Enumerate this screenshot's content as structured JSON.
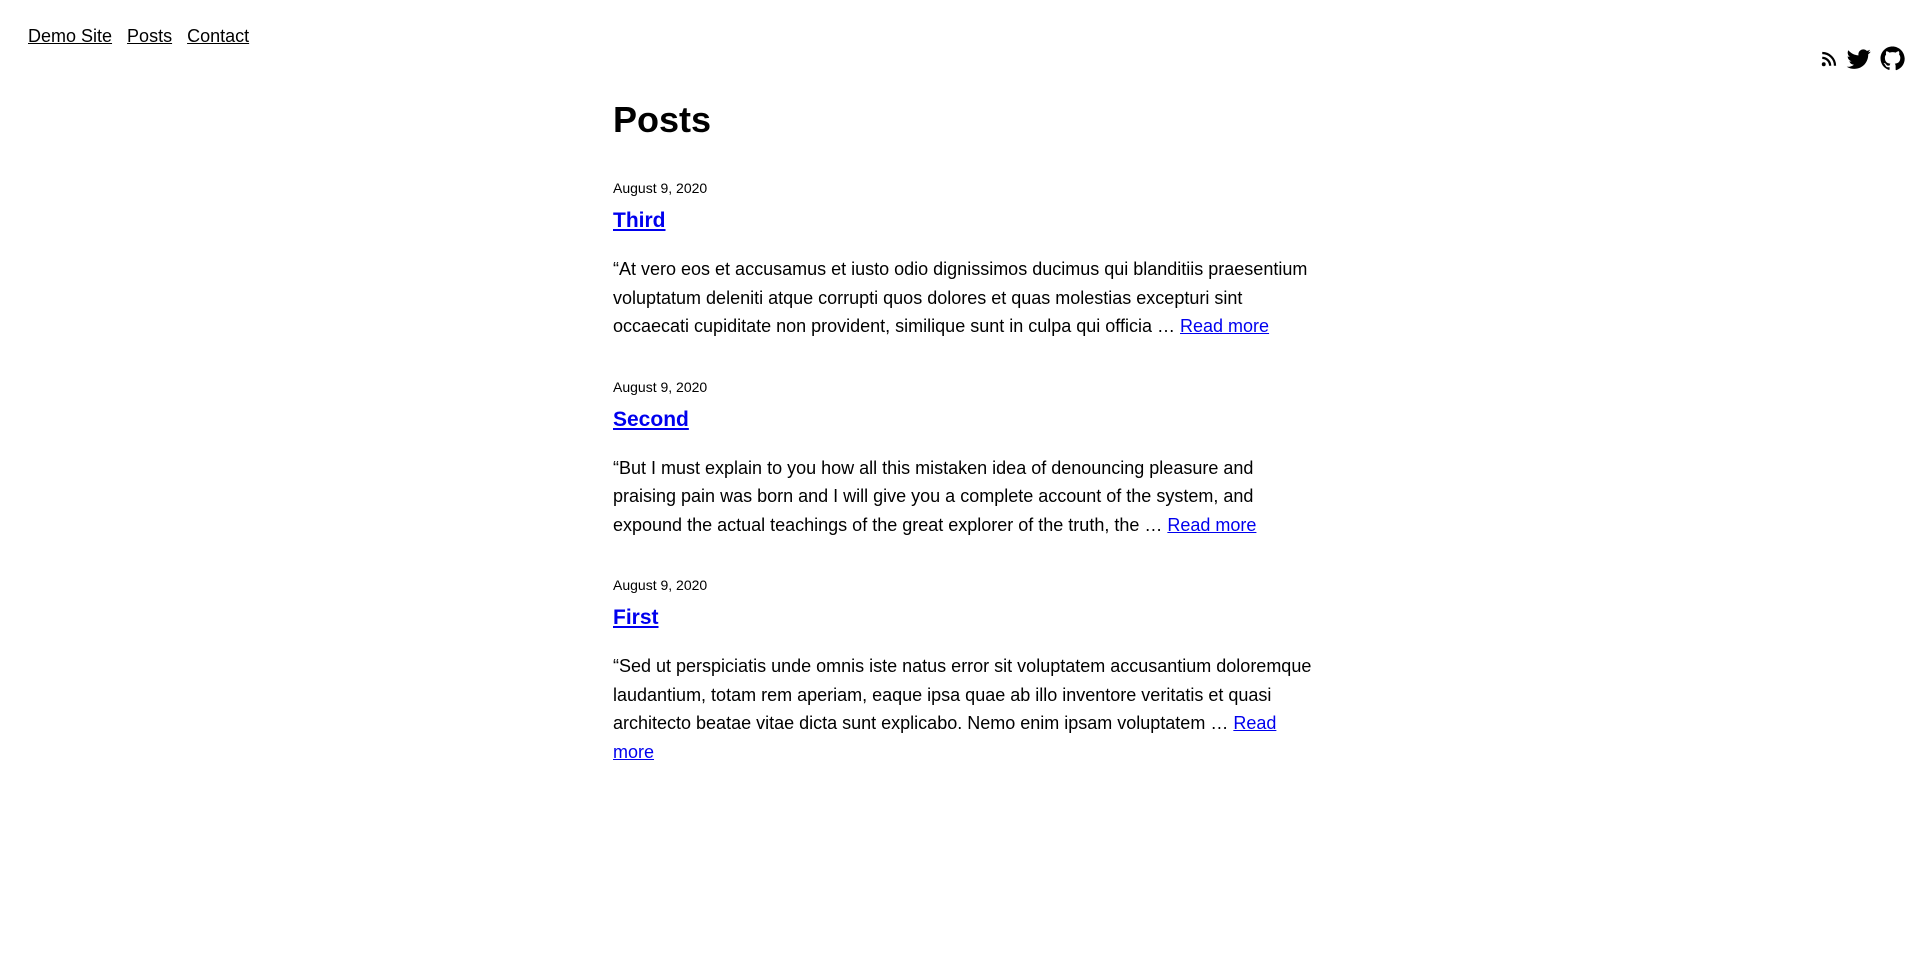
{
  "nav": {
    "items": [
      {
        "label": "Demo Site"
      },
      {
        "label": "Posts"
      },
      {
        "label": "Contact"
      }
    ]
  },
  "social": {
    "icons": [
      "rss-icon",
      "twitter-icon",
      "github-icon"
    ]
  },
  "main": {
    "heading": "Posts",
    "posts": [
      {
        "date": "August 9, 2020",
        "title": "Third",
        "summary": "“At vero eos et accusamus et iusto odio dignissimos ducimus qui blanditiis praesentium voluptatum deleniti atque corrupti quos dolores et quas molestias excepturi sint occaecati cupiditate non provident, similique sunt in culpa qui officia …",
        "read_more": "Read more"
      },
      {
        "date": "August 9, 2020",
        "title": "Second",
        "summary": "“But I must explain to you how all this mistaken idea of denouncing pleasure and praising pain was born and I will give you a complete account of the system, and expound the actual teachings of the great explorer of the truth, the …",
        "read_more": "Read more"
      },
      {
        "date": "August 9, 2020",
        "title": "First",
        "summary": "“Sed ut perspiciatis unde omnis iste natus error sit voluptatem accusantium doloremque laudantium, totam rem aperiam, eaque ipsa quae ab illo inventore veritatis et quasi architecto beatae vitae dicta sunt explicabo. Nemo enim ipsam voluptatem …",
        "read_more": "Read more"
      }
    ]
  },
  "colors": {
    "link": "#0000ee",
    "text": "#000000",
    "background": "#ffffff"
  }
}
